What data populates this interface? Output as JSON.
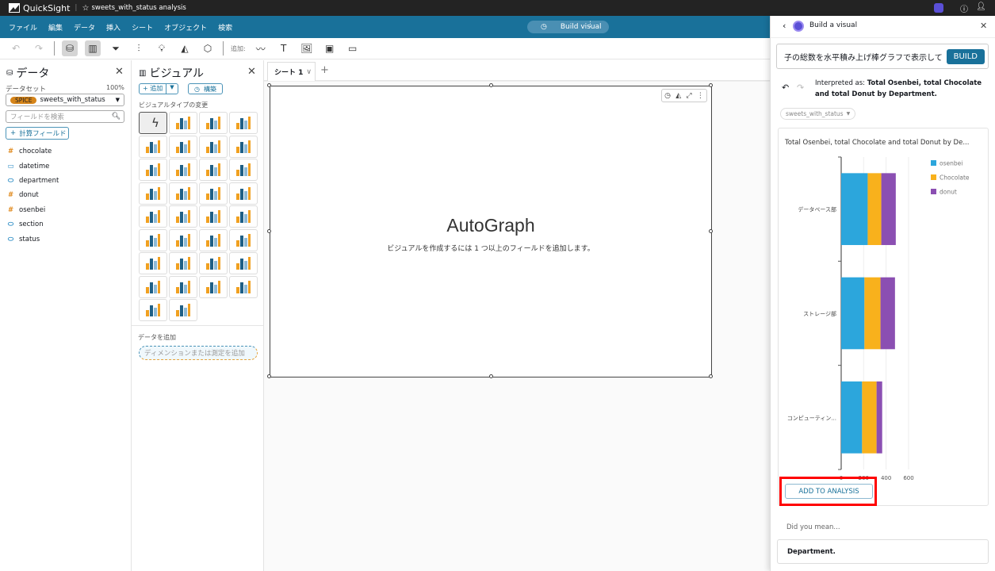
{
  "app": {
    "name": "QuickSight",
    "analysis_title": "sweets_with_status analysis"
  },
  "menu": [
    "ファイル",
    "編集",
    "データ",
    "挿入",
    "シート",
    "オブジェクト",
    "検索"
  ],
  "build_visual_label": "Build visual",
  "toolbar": {
    "add_label": "追加:"
  },
  "data_panel": {
    "title": "データ",
    "dataset_label": "データセット",
    "dataset_percent": "100%",
    "spice_badge": "SPICE",
    "dataset_name": "sweets_with_status",
    "search_placeholder": "フィールドを検索",
    "calc_field_label": "計算フィールド",
    "fields": [
      {
        "name": "chocolate",
        "type": "measure"
      },
      {
        "name": "datetime",
        "type": "date"
      },
      {
        "name": "department",
        "type": "dimension"
      },
      {
        "name": "donut",
        "type": "measure"
      },
      {
        "name": "osenbei",
        "type": "measure"
      },
      {
        "name": "section",
        "type": "dimension"
      },
      {
        "name": "status",
        "type": "dimension"
      }
    ]
  },
  "visual_panel": {
    "title": "ビジュアル",
    "add_label": "追加",
    "build_label": "構築",
    "change_type_label": "ビジュアルタイプの変更",
    "add_data_label": "データを追加",
    "add_field_placeholder": "ディメンションまたは測定を追加",
    "visual_types": [
      "autograph",
      "kpi",
      "gauge",
      "donut",
      "pie",
      "horizontal-bar",
      "vertical-bar",
      "horizontal-clustered-bar",
      "vertical-clustered-bar",
      "horizontal-stacked-bar",
      "vertical-stacked-bar",
      "waterfall",
      "line",
      "area",
      "stacked-area",
      "bar-line-combo",
      "clustered-bar-line-combo",
      "box-plot",
      "pivot-table",
      "table",
      "heat-map",
      "tree-map",
      "scatter",
      "histogram",
      "funnel",
      "sankey",
      "filled-map",
      "points-map",
      "geo-map",
      "radar",
      "insight",
      "word-cloud",
      "custom-content",
      "highcharts"
    ]
  },
  "sheet": {
    "tab_label": "シート 1"
  },
  "visual": {
    "title": "AutoGraph",
    "hint": "ビジュアルを作成するには 1 つ以上のフィールドを追加します。"
  },
  "build_panel": {
    "title": "Build a visual",
    "prompt_value": "子の総数を水平積み上げ棒グラフで表示して",
    "build_button": "BUILD",
    "interpreted_prefix": "Interpreted as: ",
    "interpreted_text": "Total Osenbei, total Chocolate and total Donut by Department.",
    "dataset_chip": "sweets_with_status",
    "add_to_analysis": "ADD TO ANALYSIS",
    "did_you_mean": "Did you mean...",
    "suggestion": "Department."
  },
  "colors": {
    "osenbei": "#2ca6dc",
    "chocolate": "#f8b11c",
    "donut": "#8b4fb2",
    "menubar": "#19719a",
    "highlight": "#ff0000"
  },
  "chart_data": {
    "type": "bar",
    "orientation": "horizontal",
    "stacked": true,
    "title": "Total Osenbei, total Chocolate and total Donut by De...",
    "categories": [
      "データベース部",
      "ストレージ部",
      "コンピューティン..."
    ],
    "series": [
      {
        "name": "osenbei",
        "values": [
          236,
          207,
          186
        ]
      },
      {
        "name": "Chocolate",
        "values": [
          121,
          143,
          129
        ]
      },
      {
        "name": "donut",
        "values": [
          129,
          129,
          50
        ]
      }
    ],
    "xticks": [
      "0",
      "200",
      "400",
      "600"
    ],
    "xlim": [
      0,
      600
    ],
    "grid": true,
    "legend": "top-right"
  }
}
